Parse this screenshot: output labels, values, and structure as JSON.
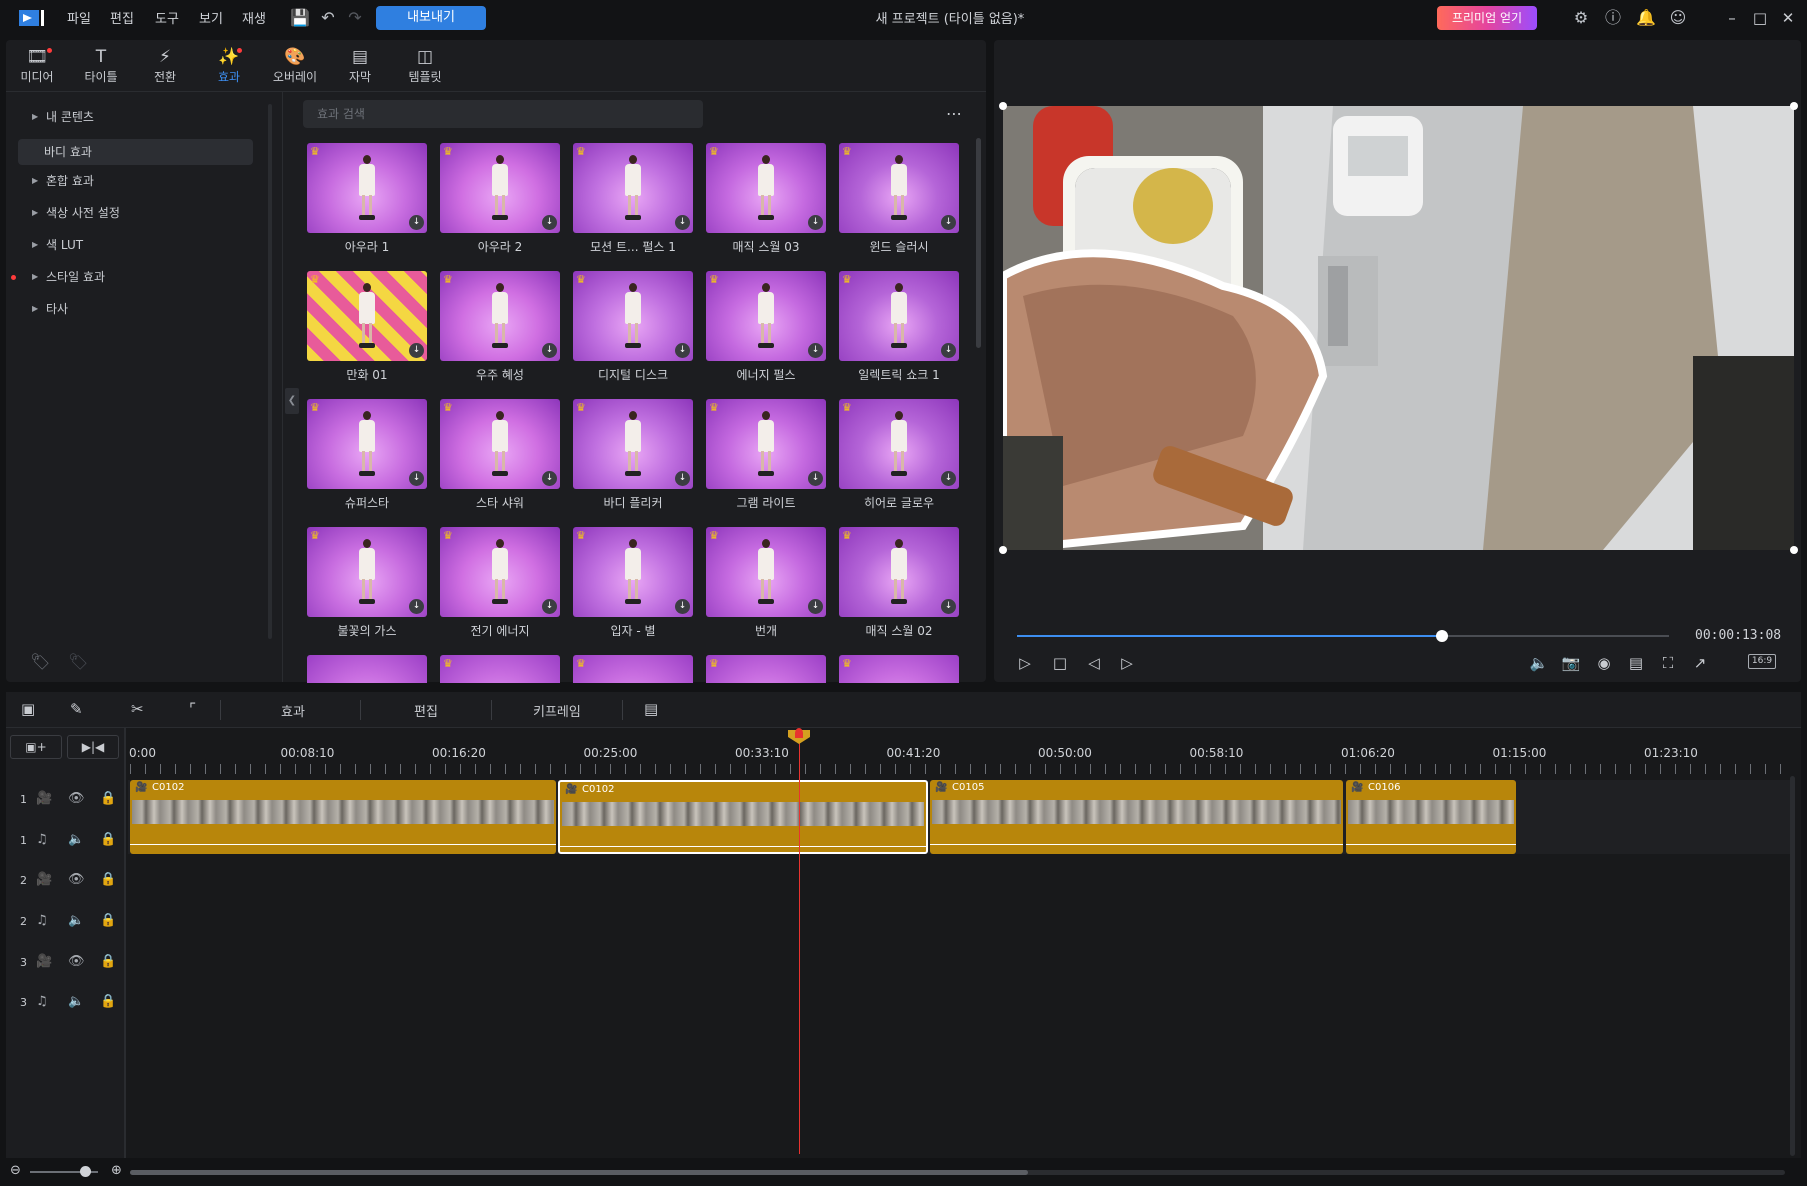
{
  "titlebar": {
    "menus": [
      "파일",
      "편집",
      "도구",
      "보기",
      "재생"
    ],
    "export_label": "내보내기",
    "project_title": "새 프로젝트 (타이틀 없음)*",
    "premium_label": "프리미엄 얻기"
  },
  "tabs": [
    {
      "label": "미디어",
      "icon": "media-icon"
    },
    {
      "label": "타이틀",
      "icon": "title-icon"
    },
    {
      "label": "전환",
      "icon": "transition-icon"
    },
    {
      "label": "효과",
      "icon": "effects-icon",
      "active": true
    },
    {
      "label": "오버레이",
      "icon": "overlay-icon"
    },
    {
      "label": "자막",
      "icon": "subtitle-icon"
    },
    {
      "label": "템플릿",
      "icon": "template-icon"
    }
  ],
  "sidebar": {
    "items": [
      {
        "label": "내 콘텐츠"
      },
      {
        "label": "바디 효과",
        "active": true
      },
      {
        "label": "혼합 효과"
      },
      {
        "label": "색상 사전 설정"
      },
      {
        "label": "색 LUT"
      },
      {
        "label": "스타일 효과"
      },
      {
        "label": "타사"
      }
    ]
  },
  "search": {
    "placeholder": "효과 검색"
  },
  "effects": [
    "아우라 1",
    "아우라 2",
    "모션 트... 펄스 1",
    "매직 스월 03",
    "윈드 슬러시",
    "만화 01",
    "우주 혜성",
    "디지털 디스크",
    "에너지 펄스",
    "일렉트릭 쇼크 1",
    "슈퍼스타",
    "스타 샤워",
    "바디 플리커",
    "그램 라이트",
    "히어로 글로우",
    "불꽃의 가스",
    "전기 에너지",
    "입자 - 별",
    "번개",
    "매직 스월 02"
  ],
  "preview": {
    "timecode": "00:00:13:08",
    "progress": 0.652,
    "aspect_label": "16:9"
  },
  "timeline_toolbar": {
    "effects_label": "효과",
    "edit_label": "편집",
    "keyframe_label": "키프레임"
  },
  "ruler": [
    "0:00",
    "00:08:10",
    "00:16:20",
    "00:25:00",
    "00:33:10",
    "00:41:20",
    "00:50:00",
    "00:58:10",
    "01:06:20",
    "01:15:00",
    "01:23:10"
  ],
  "tracks": [
    {
      "num": "1",
      "type": "video"
    },
    {
      "num": "1",
      "type": "audio"
    },
    {
      "num": "2",
      "type": "video"
    },
    {
      "num": "2",
      "type": "audio"
    },
    {
      "num": "3",
      "type": "video"
    },
    {
      "num": "3",
      "type": "audio"
    }
  ],
  "clips": [
    "C0102",
    "C0102",
    "C0105",
    "C0106"
  ],
  "colors": {
    "accent": "#3d8ef0",
    "clip": "#b8860b",
    "playhead": "#e8332f"
  }
}
